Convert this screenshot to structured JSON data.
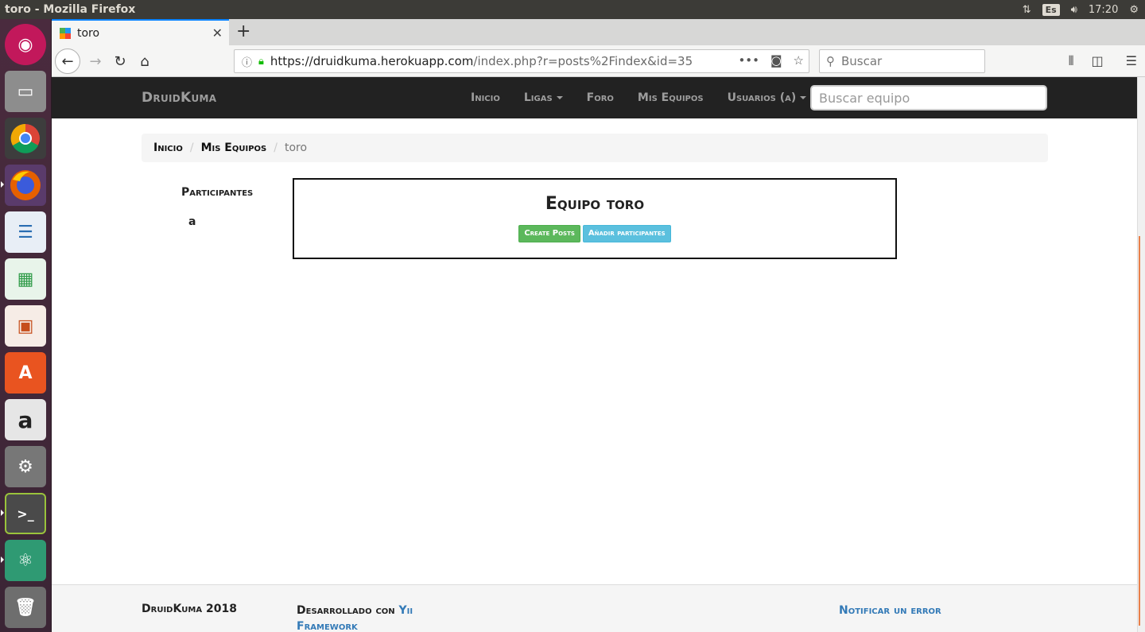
{
  "os": {
    "window_title": "toro - Mozilla Firefox",
    "keyboard_layout": "Es",
    "clock": "17:20"
  },
  "launcher": {
    "apps": [
      {
        "name": "ubuntu-dash-icon",
        "color": "#c2185b"
      },
      {
        "name": "files-icon",
        "color": "#8d8d8d"
      },
      {
        "name": "chrome-icon",
        "color": "#3d3d3d"
      },
      {
        "name": "firefox-icon",
        "color": "#e66000"
      },
      {
        "name": "libreoffice-writer-icon",
        "color": "#2a6db2"
      },
      {
        "name": "libreoffice-calc-icon",
        "color": "#2f9b48"
      },
      {
        "name": "libreoffice-impress-icon",
        "color": "#c64e1c"
      },
      {
        "name": "ubuntu-software-icon",
        "color": "#e95420"
      },
      {
        "name": "amazon-icon",
        "color": "#e6e6e6"
      },
      {
        "name": "system-settings-icon",
        "color": "#777777"
      },
      {
        "name": "terminal-icon",
        "color": "#4a4a4a"
      },
      {
        "name": "atom-icon",
        "color": "#2f9a73"
      },
      {
        "name": "trash-icon",
        "color": "#6e6e6e"
      }
    ]
  },
  "browser": {
    "tab_title": "toro",
    "url_host": "https://druidkuma.herokuapp.com",
    "url_path": "/index.php?r=posts%2Findex&id=35",
    "search_placeholder": "Buscar"
  },
  "site": {
    "brand": "DruidKuma",
    "menu": {
      "inicio": "Inicio",
      "ligas": "Ligas",
      "foro": "Foro",
      "mis_equipos": "Mis Equipos",
      "usuarios": "Usuarios (a)"
    },
    "search_placeholder": "Buscar equipo",
    "breadcrumb": {
      "home": "Inicio",
      "parent": "Mis Equipos",
      "current": "toro"
    },
    "sidebar": {
      "title": "Participantes",
      "members": [
        "a"
      ]
    },
    "team": {
      "title": "Equipo toro",
      "create_posts": "Create Posts",
      "add_participants": "Añadir participantes"
    },
    "footer": {
      "copyright": "DruidKuma 2018",
      "developed_prefix": "Desarrollado con",
      "framework_link": "Yii Framework",
      "report_link": "Notificar un error"
    }
  },
  "colors": {
    "navbar_bg": "#222222",
    "success": "#5cb85c",
    "info": "#5bc0de",
    "link": "#337ab7"
  }
}
